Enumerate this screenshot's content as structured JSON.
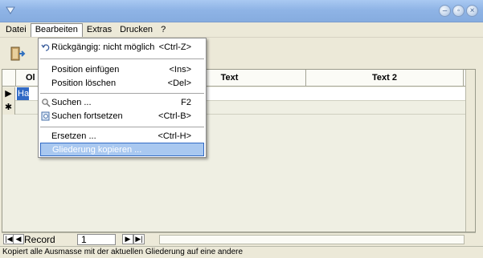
{
  "menubar": {
    "items": [
      "Datei",
      "Bearbeiten",
      "Extras",
      "Drucken",
      "?"
    ]
  },
  "grid": {
    "columns": [
      "Ol",
      "",
      "Text",
      "Text 2"
    ],
    "selected_cell": "Ha",
    "row_markers": [
      "▶",
      "✱"
    ]
  },
  "navigator": {
    "label": "Record",
    "value": "1"
  },
  "statusbar": {
    "text": "Kopiert alle Ausmasse mit der aktuellen Gliederung auf eine andere"
  },
  "dropdown": {
    "items": [
      {
        "label": "Rückgängig: nicht möglich",
        "shortcut": "<Ctrl-Z>"
      },
      {
        "label": "Position einfügen",
        "shortcut": "<Ins>"
      },
      {
        "label": "Position löschen",
        "shortcut": "<Del>"
      },
      {
        "label": "Suchen ...",
        "shortcut": "F2"
      },
      {
        "label": "Suchen fortsetzen",
        "shortcut": "<Ctrl-B>"
      },
      {
        "label": "Ersetzen ...",
        "shortcut": "<Ctrl-H>"
      },
      {
        "label": "Gliederung kopieren ...",
        "shortcut": ""
      }
    ]
  }
}
